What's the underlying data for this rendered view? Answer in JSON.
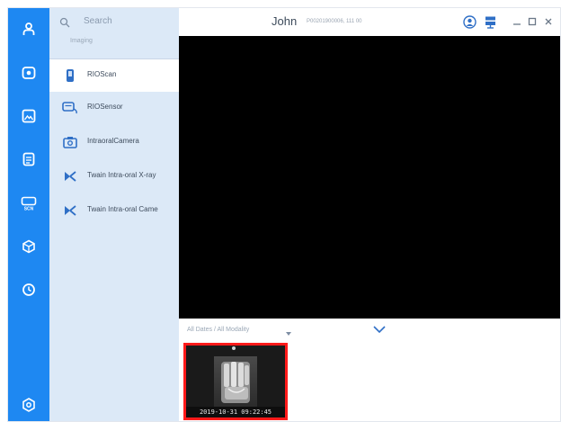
{
  "window": {
    "patient_name": "John",
    "patient_info": "P00201900006, 111 00"
  },
  "search": {
    "placeholder": "Search",
    "section_label": "Imaging"
  },
  "devices": [
    {
      "label": "RIOScan",
      "icon": "scanner-icon"
    },
    {
      "label": "RIOSensor",
      "icon": "sensor-icon"
    },
    {
      "label": "IntraoralCamera",
      "icon": "camera-icon"
    },
    {
      "label": "Twain Intra-oral X-ray",
      "icon": "twain-icon"
    },
    {
      "label": "Twain Intra-oral Came",
      "icon": "twain-icon"
    }
  ],
  "rail": [
    "patient-icon",
    "imaging-icon",
    "image-icon",
    "report-icon",
    "scan-icon",
    "3d-icon",
    "history-icon",
    "settings-icon"
  ],
  "filter": {
    "label": "All Dates / All Modality"
  },
  "thumbnails": [
    {
      "timestamp": "2019-10-31 09:22:45"
    }
  ],
  "colors": {
    "rail": "#1e88f2",
    "panel": "#dce9f7",
    "selection_border": "#ff1a1a",
    "accent": "#1e88f2"
  }
}
